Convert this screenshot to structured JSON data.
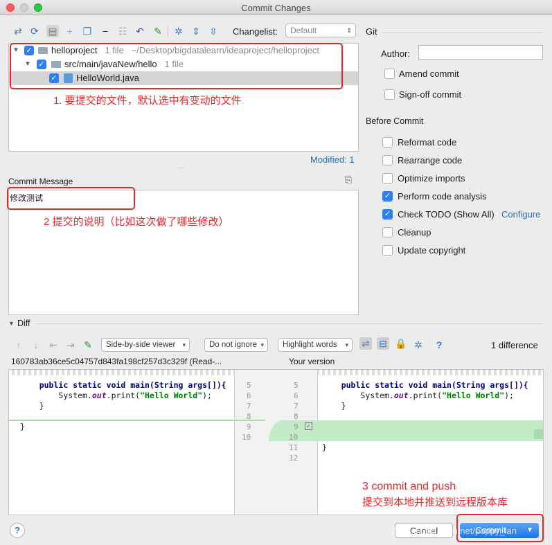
{
  "window": {
    "title": "Commit Changes"
  },
  "toolbar": {
    "changelist_label": "Changelist:",
    "changelist_value": "Default"
  },
  "tree": {
    "root": {
      "name": "helloproject",
      "count": "1 file",
      "path": "~/Desktop/bigdatalearn/ideaproject/helloproject"
    },
    "folder": {
      "name": "src/main/javaNew/hello",
      "count": "1 file"
    },
    "file": {
      "name": "HelloWorld.java"
    },
    "modified": "Modified: 1"
  },
  "annotations": {
    "files_note": "1. 要提交的文件，默认选中有变动的文件",
    "message_note": "2 提交的说明（比如这次做了哪些修改）",
    "commit_note_line1": "3 commit and push",
    "commit_note_line2": "提交到本地并推送到远程版本库"
  },
  "commit_message": {
    "label": "Commit Message",
    "value": "修改测试"
  },
  "git": {
    "title": "Git",
    "author_label": "Author:",
    "author_value": "",
    "amend": "Amend commit",
    "signoff": "Sign-off commit"
  },
  "before_commit": {
    "title": "Before Commit",
    "options": [
      {
        "label": "Reformat code",
        "checked": false
      },
      {
        "label": "Rearrange code",
        "checked": false
      },
      {
        "label": "Optimize imports",
        "checked": false
      },
      {
        "label": "Perform code analysis",
        "checked": true
      },
      {
        "label": "Check TODO (Show All)",
        "checked": true
      },
      {
        "label": "Cleanup",
        "checked": false
      },
      {
        "label": "Update copyright",
        "checked": false
      }
    ],
    "configure_link": "Configure"
  },
  "diff": {
    "title": "Diff",
    "viewer": "Side-by-side viewer",
    "ignore": "Do not ignore",
    "highlight": "Highlight words",
    "differences": "1 difference",
    "left_header": "160783ab36ce5c04757d843fa198cf257d3c329f (Read-...",
    "right_header": "Your version",
    "left_lines": [
      "5",
      "6",
      "7",
      "8",
      "9",
      "10"
    ],
    "right_lines": [
      "5",
      "6",
      "7",
      "8",
      "9",
      "10",
      "11",
      "12"
    ],
    "code_main": "public static void main(String args[]){",
    "code_print_pre": "System.",
    "code_print_out": "out",
    "code_print_mid": ".print(",
    "code_print_str": "\"Hello World\"",
    "code_print_end": ");",
    "code_brace": "}"
  },
  "footer": {
    "help": "?",
    "cancel": "Cancel",
    "commit": "Commit",
    "watermark": "https://blog.csdn.net/poppy_lan"
  }
}
